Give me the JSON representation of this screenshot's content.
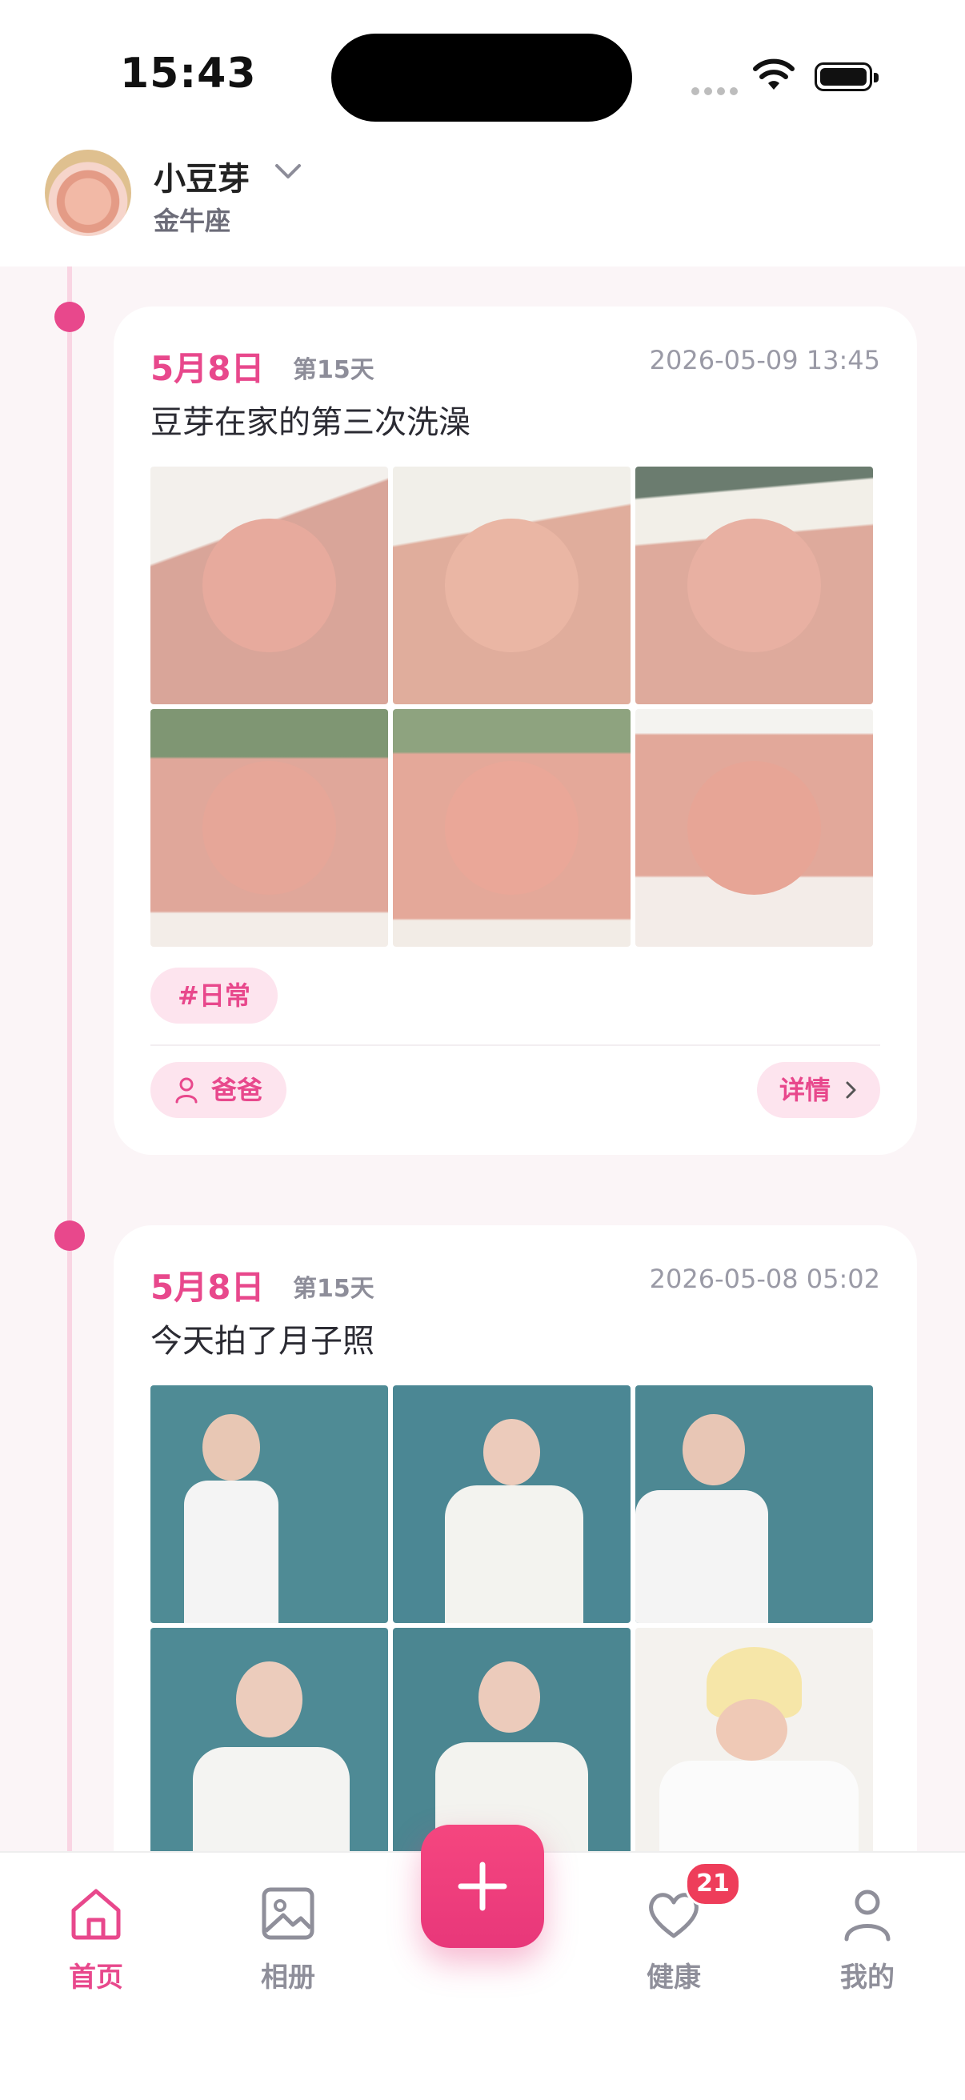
{
  "status_bar": {
    "time": "15:43"
  },
  "header": {
    "baby_name": "小豆芽",
    "zodiac": "金牛座"
  },
  "feed": {
    "posts": [
      {
        "date": "5月8日",
        "day": "第15天",
        "timestamp": "2026-05-09 13:45",
        "title": "豆芽在家的第三次洗澡",
        "tag": "#日常",
        "author": "爸爸",
        "detail_label": "详情"
      },
      {
        "date": "5月8日",
        "day": "第15天",
        "timestamp": "2026-05-08 05:02",
        "title": "今天拍了月子照"
      }
    ]
  },
  "nav": {
    "items": [
      {
        "label": "首页",
        "icon": "home-icon",
        "active": true
      },
      {
        "label": "相册",
        "icon": "image-icon",
        "active": false
      },
      {
        "label": "健康",
        "icon": "heart-icon",
        "active": false,
        "badge": "21"
      },
      {
        "label": "我的",
        "icon": "user-icon",
        "active": false
      }
    ],
    "fab_icon": "plus-icon"
  },
  "colors": {
    "accent": "#e8488c",
    "tag_bg": "#fde4ee",
    "badge": "#ee3d5a"
  }
}
